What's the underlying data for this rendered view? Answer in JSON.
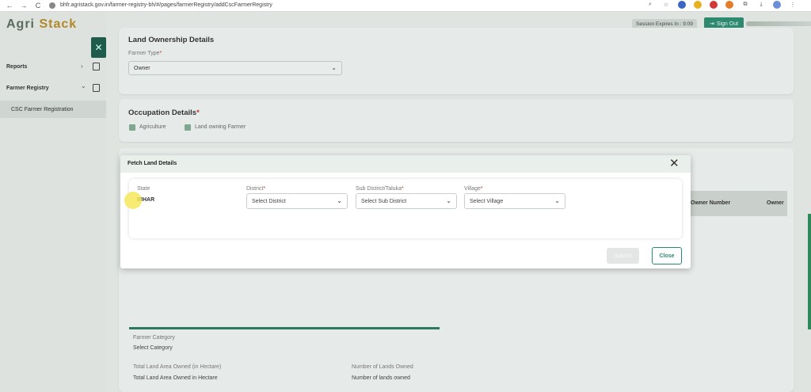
{
  "browser": {
    "url": "bhfr.agristack.gov.in/farmer-registry-bh/#/pages/farmerRegistry/addCscFarmerRegistry",
    "back": "←",
    "forward": "→",
    "reload": "C"
  },
  "app": {
    "logo_prefix": "Agri ",
    "logo_suffix": "Stack",
    "session_text": "Session Expires In : 9:09",
    "sign_out": "Sign Out"
  },
  "sidebar": {
    "close_glyph": "✕",
    "items": [
      {
        "label": "Reports",
        "chevron": "›"
      },
      {
        "label": "Farmer Registry",
        "chevron": "⌄"
      }
    ],
    "sub_item": "CSC Farmer Registration"
  },
  "land_ownership": {
    "title": "Land Ownership Details",
    "farmer_type_label": "Farmer Type",
    "farmer_type_value": "Owner"
  },
  "occupation": {
    "title": "Occupation Details",
    "options": [
      "Agriculture",
      "Land owning Farmer"
    ]
  },
  "table": {
    "col_owner_number": "Owner Number",
    "col_owner": "Owner"
  },
  "bottom": {
    "farmer_category_label": "Farmer Category",
    "farmer_category_value": "Select Category",
    "total_area_label": "Total Land Area Owned (in Hectare)",
    "total_area_value": "Total Land Area Owned in Hectare",
    "num_lands_label": "Number of Lands Owned",
    "num_lands_value": "Number of lands owned"
  },
  "modal": {
    "title": "Fetch Land Details",
    "close_glyph": "✕",
    "state_label": "State",
    "state_value": "BIHAR",
    "district_label": "District",
    "district_placeholder": "Select District",
    "subdistrict_label": "Sub District/Taluka",
    "subdistrict_placeholder": "Select Sub District",
    "village_label": "Village",
    "village_placeholder": "Select Village",
    "submit": "Submit",
    "close": "Close"
  }
}
